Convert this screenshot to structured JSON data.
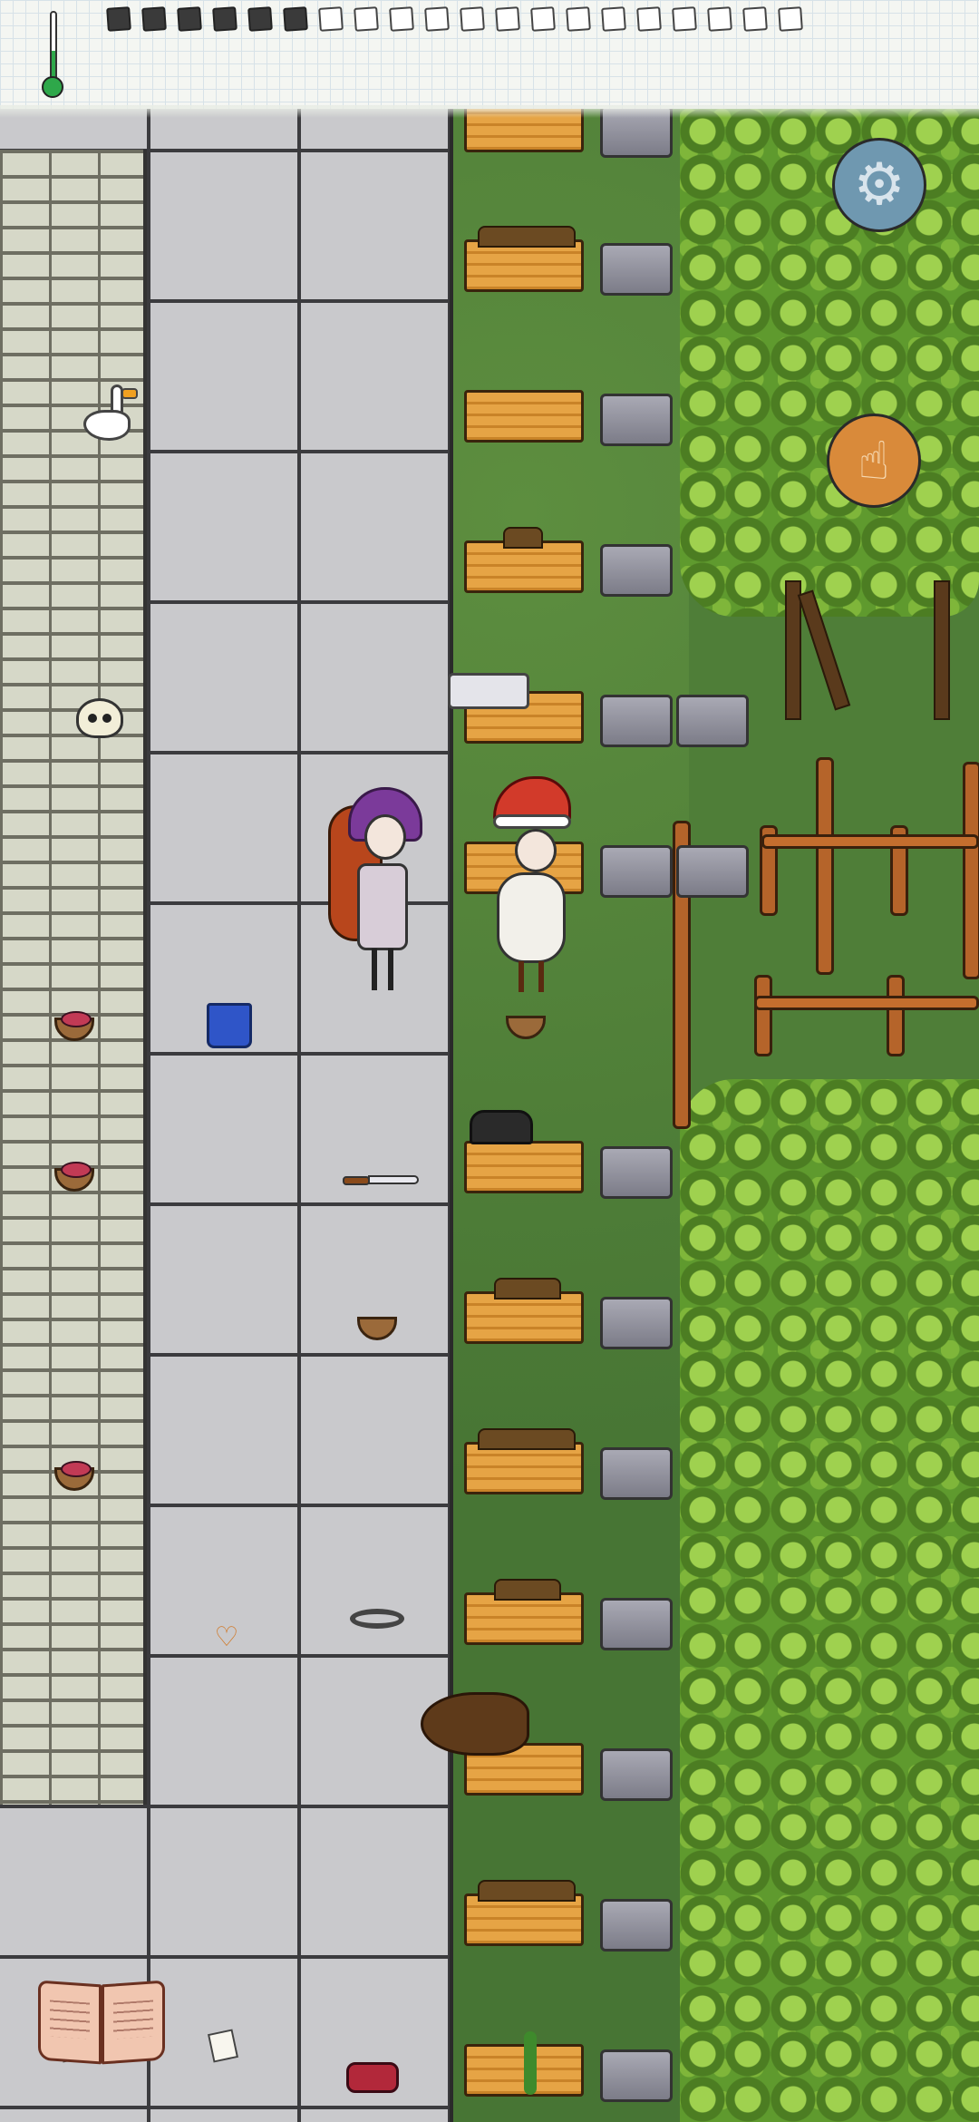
{
  "hud": {
    "temperature_icon": "thermometer-icon",
    "food_meter": {
      "filled": 6,
      "total": 20
    }
  },
  "buttons": {
    "settings_icon": "gear-icon",
    "use_icon": "pointing-hand-icon",
    "recipe_book_icon": "open-book-icon"
  },
  "icons": {
    "settings": "⚙",
    "use": "☝",
    "heart": "♡"
  },
  "colors": {
    "food_filled": "#3a3a3a",
    "temperature": "#2ea84a",
    "settings_button": "#6f98b0",
    "use_button": "#d98a3a"
  },
  "scene": {
    "characters": [
      {
        "name": "player-red-hair",
        "hat": "purple-turban",
        "holding": "bowl"
      },
      {
        "name": "npc-santa-hat",
        "wearing": "sheepskin"
      }
    ],
    "objects": [
      "goose",
      "skull-and-bones",
      "blue-pants",
      "knife",
      "black-hat",
      "heart-pendant",
      "paper-note",
      "bear-skin",
      "berry-basket",
      "empty-basket",
      "crates",
      "stone-blocks",
      "wooden-fence",
      "hedge-trees"
    ]
  }
}
